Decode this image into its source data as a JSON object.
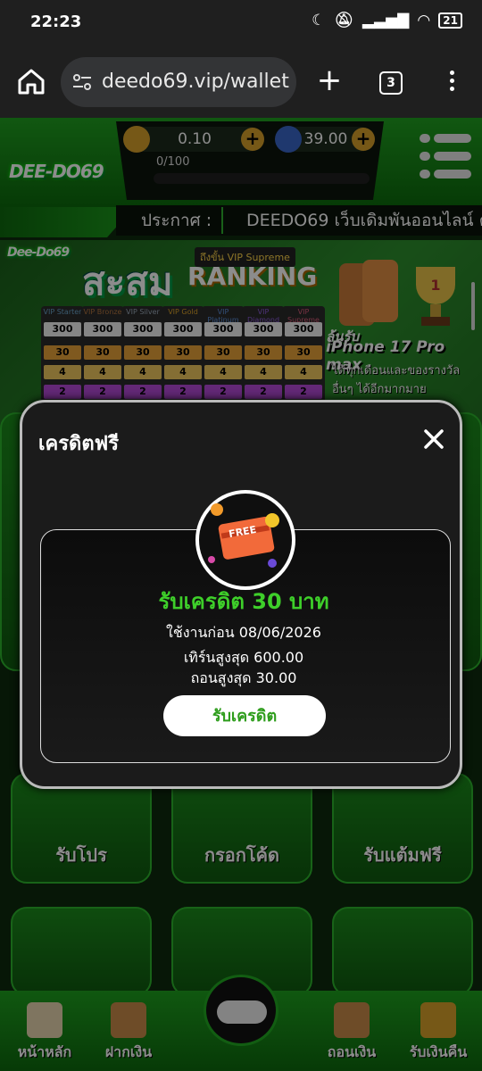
{
  "status": {
    "time": "22:23",
    "battery": "21"
  },
  "browser": {
    "url": "deedo69.vip/wallet",
    "tab_count": "3"
  },
  "header": {
    "logo": "DEE-DO69",
    "balance": "0.10",
    "points": "39.00",
    "progress_text": "0/100",
    "progress": 0
  },
  "announcement": {
    "label": "ประกาศ :",
    "message": "DEEDO69 เว็บเดิมพันออนไลน์ ครบวงจร"
  },
  "banner": {
    "logo": "Dee-Do69",
    "title": "สะสม",
    "ranking": "RANKING",
    "vip_prefix": "ถึงขั้น VIP Supreme",
    "tiers": [
      {
        "name": "VIP Starter",
        "color": "#6aa3c8",
        "v1": "300",
        "v2": "30",
        "v3": "4",
        "v4": "2"
      },
      {
        "name": "VIP Bronze",
        "color": "#b2753f",
        "v1": "300",
        "v2": "30",
        "v3": "4",
        "v4": "2"
      },
      {
        "name": "VIP Silver",
        "color": "#9aa8b8",
        "v1": "300",
        "v2": "30",
        "v3": "4",
        "v4": "2"
      },
      {
        "name": "VIP Gold",
        "color": "#d9a12a",
        "v1": "300",
        "v2": "30",
        "v3": "4",
        "v4": "2"
      },
      {
        "name": "VIP Platinum",
        "color": "#5c8ed8",
        "v1": "300",
        "v2": "30",
        "v3": "4",
        "v4": "2"
      },
      {
        "name": "VIP Diamond",
        "color": "#8a5cd8",
        "v1": "300",
        "v2": "30",
        "v3": "4",
        "v4": "2"
      },
      {
        "name": "VIP Supreme",
        "color": "#d85c7a",
        "v1": "300",
        "v2": "30",
        "v3": "4",
        "v4": "2"
      }
    ],
    "prize_line1": "ลุ้นรับ",
    "prize_model": "iPhone 17 Pro max",
    "prize_sub": "ได้ทุกเดือนและของรางวัลอื่นๆ ได้อีกมากมาย"
  },
  "tiles": [
    {
      "label": "รับโปร"
    },
    {
      "label": "กรอกโค้ด"
    },
    {
      "label": "รับแต้มฟรี"
    }
  ],
  "bottom_nav": [
    {
      "label": "หน้าหลัก"
    },
    {
      "label": "ฝากเงิน"
    },
    {
      "label": "ถอนเงิน"
    },
    {
      "label": "รับเงินคืน"
    }
  ],
  "modal": {
    "title": "เครดิตฟรี",
    "badge_text": "FREE",
    "credit_title": "รับเครดิต 30 บาท",
    "use_before": "ใช้งานก่อน 08/06/2026",
    "max_turnover": "เทิร์นสูงสุด 600.00",
    "max_withdraw": "ถอนสูงสุด 30.00",
    "claim_label": "รับเครดิต"
  },
  "colors": {
    "accent_green": "#3ecf2a",
    "gold": "#d8a12a"
  }
}
